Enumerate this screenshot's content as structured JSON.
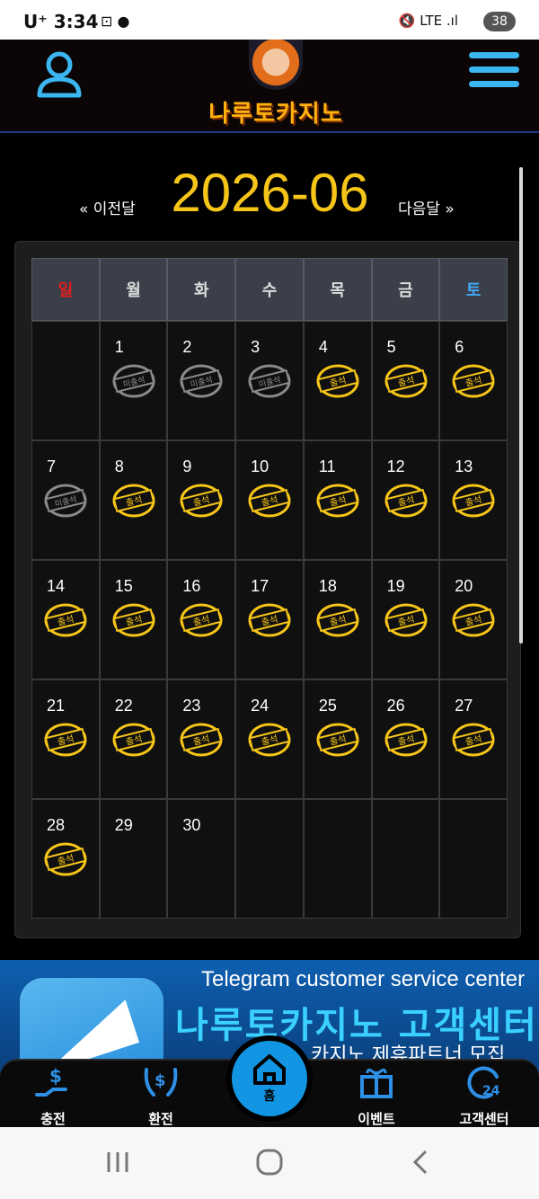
{
  "status_bar": {
    "time": "3:34",
    "carrier": "U⁺",
    "network": "LTE",
    "battery": "38"
  },
  "header": {
    "logo_text": "나루토카지노"
  },
  "calendar": {
    "month_title": "2026-06",
    "prev_label": "« 이전달",
    "next_label": "다음달 »",
    "weekdays": [
      "일",
      "월",
      "화",
      "수",
      "목",
      "금",
      "토"
    ],
    "stamp_attended": "출석",
    "stamp_absent": "미출석",
    "weeks": [
      [
        {
          "day": "",
          "stamp": ""
        },
        {
          "day": "1",
          "stamp": "absent"
        },
        {
          "day": "2",
          "stamp": "absent"
        },
        {
          "day": "3",
          "stamp": "absent"
        },
        {
          "day": "4",
          "stamp": "attended"
        },
        {
          "day": "5",
          "stamp": "attended"
        },
        {
          "day": "6",
          "stamp": "attended"
        }
      ],
      [
        {
          "day": "7",
          "stamp": "absent"
        },
        {
          "day": "8",
          "stamp": "attended"
        },
        {
          "day": "9",
          "stamp": "attended"
        },
        {
          "day": "10",
          "stamp": "attended"
        },
        {
          "day": "11",
          "stamp": "attended"
        },
        {
          "day": "12",
          "stamp": "attended"
        },
        {
          "day": "13",
          "stamp": "attended"
        }
      ],
      [
        {
          "day": "14",
          "stamp": "attended"
        },
        {
          "day": "15",
          "stamp": "attended"
        },
        {
          "day": "16",
          "stamp": "attended"
        },
        {
          "day": "17",
          "stamp": "attended"
        },
        {
          "day": "18",
          "stamp": "attended"
        },
        {
          "day": "19",
          "stamp": "attended"
        },
        {
          "day": "20",
          "stamp": "attended"
        }
      ],
      [
        {
          "day": "21",
          "stamp": "attended"
        },
        {
          "day": "22",
          "stamp": "attended"
        },
        {
          "day": "23",
          "stamp": "attended"
        },
        {
          "day": "24",
          "stamp": "attended"
        },
        {
          "day": "25",
          "stamp": "attended"
        },
        {
          "day": "26",
          "stamp": "attended"
        },
        {
          "day": "27",
          "stamp": "attended"
        }
      ],
      [
        {
          "day": "28",
          "stamp": "attended"
        },
        {
          "day": "29",
          "stamp": ""
        },
        {
          "day": "30",
          "stamp": ""
        },
        {
          "day": "",
          "stamp": ""
        },
        {
          "day": "",
          "stamp": ""
        },
        {
          "day": "",
          "stamp": ""
        },
        {
          "day": "",
          "stamp": ""
        }
      ]
    ]
  },
  "banner": {
    "en_text": "Telegram customer service center",
    "ko_text": "나루토카지노 고객센터",
    "sub_text": "카지노 제휴파트너 모집"
  },
  "bottom_nav": {
    "items": [
      {
        "label": "충전",
        "icon": "deposit-icon"
      },
      {
        "label": "환전",
        "icon": "withdraw-icon"
      },
      {
        "label": "홈",
        "icon": "home-icon"
      },
      {
        "label": "이벤트",
        "icon": "gift-icon"
      },
      {
        "label": "고객센터",
        "icon": "support-24-icon"
      }
    ]
  },
  "colors": {
    "accent": "#f6c518",
    "nav_blue": "#1296e4",
    "sunday": "#e11d1d",
    "saturday": "#3fa9f5"
  }
}
